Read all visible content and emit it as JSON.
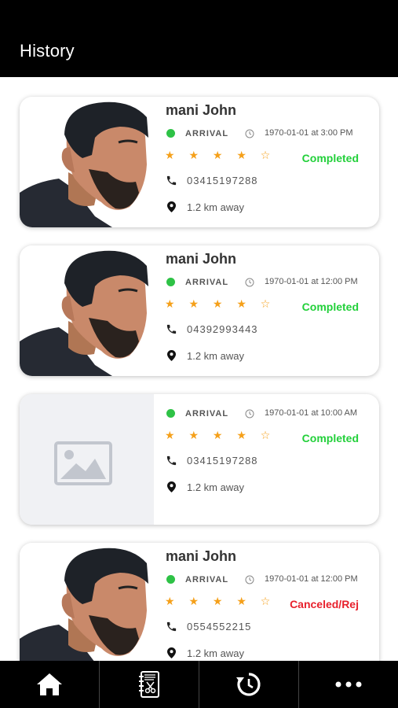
{
  "header": {
    "title": "History"
  },
  "cards": [
    {
      "name": "mani John",
      "type": "ARRIVAL",
      "datetime": "1970-01-01 at 3:00 PM",
      "rating": 4,
      "stars": "★ ★ ★ ★ ☆",
      "status": "Completed",
      "status_color": "#22d03a",
      "phone": "03415197288",
      "distance": "1.2 km away",
      "photo": "person"
    },
    {
      "name": "mani John",
      "type": "ARRIVAL",
      "datetime": "1970-01-01 at 12:00 PM",
      "rating": 4,
      "stars": "★ ★ ★ ★ ☆",
      "status": "Completed",
      "status_color": "#22d03a",
      "phone": "04392993443",
      "distance": "1.2 km away",
      "photo": "person"
    },
    {
      "name": "",
      "type": "ARRIVAL",
      "datetime": "1970-01-01 at 10:00 AM",
      "rating": 4,
      "stars": "★ ★ ★ ★ ☆",
      "status": "Completed",
      "status_color": "#22d03a",
      "phone": "03415197288",
      "distance": "1.2 km away",
      "photo": "placeholder"
    },
    {
      "name": "mani John",
      "type": "ARRIVAL",
      "datetime": "1970-01-01 at 12:00 PM",
      "rating": 4,
      "stars": "★ ★ ★ ★ ☆",
      "status": "Canceled/Rej",
      "status_color": "#e8212c",
      "phone": "0554552215",
      "distance": "1.2 km away",
      "photo": "person"
    }
  ],
  "tabbar": {
    "items": [
      {
        "icon": "home-icon"
      },
      {
        "icon": "notebook-scissors-icon"
      },
      {
        "icon": "history-icon"
      },
      {
        "icon": "more-icon"
      }
    ]
  },
  "colors": {
    "header_bg": "#000000",
    "status_dot": "#2ec246",
    "star": "#f5a01a"
  }
}
